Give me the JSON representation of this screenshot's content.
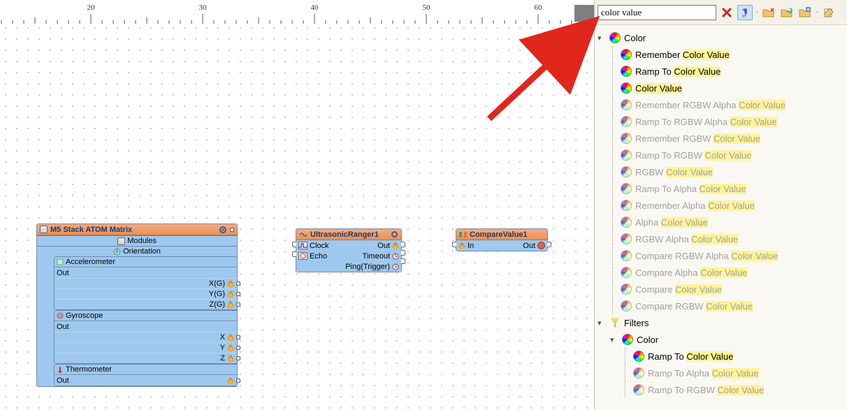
{
  "ruler": {
    "ticks": [
      20,
      30,
      40,
      50,
      60
    ]
  },
  "search": {
    "value": "color value"
  },
  "arrow_target": "search-input",
  "nodes": {
    "m5": {
      "title": "M5 Stack ATOM Matrix",
      "modules_label": "Modules",
      "orientation_label": "Orientation",
      "accel": {
        "title": "Accelerometer",
        "out_label": "Out",
        "pins": [
          "X(G)",
          "Y(G)",
          "Z(G)"
        ]
      },
      "gyro": {
        "title": "Gyroscope",
        "out_label": "Out",
        "pins": [
          "X",
          "Y",
          "Z"
        ]
      },
      "thermo": {
        "title": "Thermometer",
        "out_label": "Out"
      }
    },
    "ultra": {
      "title": "UltrasonicRanger1",
      "left": [
        {
          "icon": "pulse",
          "label": "Clock"
        },
        {
          "icon": "echo",
          "label": "Echo"
        }
      ],
      "right": [
        {
          "label": "Out"
        },
        {
          "label": "Timeout"
        },
        {
          "label": "Ping(Trigger)"
        }
      ]
    },
    "compare": {
      "title": "CompareValue1",
      "left": [
        {
          "icon": "flame",
          "label": "In"
        }
      ],
      "right": [
        {
          "label": "Out"
        }
      ]
    }
  },
  "tree": [
    {
      "type": "cat",
      "expanded": true,
      "icon": "color-wheel",
      "label": "Color",
      "enabled": true,
      "children": [
        {
          "icon": "color-wheel",
          "enabled": true,
          "plain": "Remember ",
          "hl": "Color Value",
          "rest": ""
        },
        {
          "icon": "color-wheel",
          "enabled": true,
          "plain": "Ramp To ",
          "hl": "Color Value",
          "rest": ""
        },
        {
          "icon": "color-wheel",
          "enabled": true,
          "plain": "",
          "hl": "Color Value",
          "rest": ""
        },
        {
          "icon": "color-wheel",
          "enabled": false,
          "plain": "Remember RGBW Alpha ",
          "hl": "Color Value",
          "rest": ""
        },
        {
          "icon": "color-wheel",
          "enabled": false,
          "plain": "Ramp To RGBW Alpha ",
          "hl": "Color Value",
          "rest": ""
        },
        {
          "icon": "color-wheel",
          "enabled": false,
          "plain": "Remember RGBW ",
          "hl": "Color Value",
          "rest": ""
        },
        {
          "icon": "color-wheel",
          "enabled": false,
          "plain": "Ramp To RGBW ",
          "hl": "Color Value",
          "rest": ""
        },
        {
          "icon": "color-wheel",
          "enabled": false,
          "plain": "RGBW ",
          "hl": "Color Value",
          "rest": ""
        },
        {
          "icon": "color-wheel",
          "enabled": false,
          "plain": "Ramp To Alpha ",
          "hl": "Color Value",
          "rest": ""
        },
        {
          "icon": "color-wheel",
          "enabled": false,
          "plain": "Remember Alpha ",
          "hl": "Color Value",
          "rest": ""
        },
        {
          "icon": "color-wheel",
          "enabled": false,
          "plain": "Alpha ",
          "hl": "Color Value",
          "rest": ""
        },
        {
          "icon": "color-wheel",
          "enabled": false,
          "plain": "RGBW Alpha ",
          "hl": "Color Value",
          "rest": ""
        },
        {
          "icon": "color-wheel",
          "enabled": false,
          "plain": "Compare RGBW Alpha ",
          "hl": "Color Value",
          "rest": ""
        },
        {
          "icon": "color-wheel",
          "enabled": false,
          "plain": "Compare Alpha ",
          "hl": "Color Value",
          "rest": ""
        },
        {
          "icon": "color-wheel",
          "enabled": false,
          "plain": "Compare ",
          "hl": "Color Value",
          "rest": ""
        },
        {
          "icon": "color-wheel",
          "enabled": false,
          "plain": "Compare RGBW ",
          "hl": "Color Value",
          "rest": ""
        }
      ]
    },
    {
      "type": "cat",
      "expanded": true,
      "icon": "filter",
      "label": "Filters",
      "enabled": true,
      "children": [
        {
          "type": "cat",
          "expanded": true,
          "icon": "color-wheel",
          "label": "Color",
          "enabled": true,
          "children": [
            {
              "icon": "color-wheel",
              "enabled": true,
              "plain": "Ramp To ",
              "hl": "Color Value",
              "rest": ""
            },
            {
              "icon": "color-wheel",
              "enabled": false,
              "plain": "Ramp To Alpha ",
              "hl": "Color Value",
              "rest": ""
            },
            {
              "icon": "color-wheel",
              "enabled": false,
              "plain": "Ramp To RGBW ",
              "hl": "Color Value",
              "rest": ""
            }
          ]
        }
      ]
    }
  ]
}
